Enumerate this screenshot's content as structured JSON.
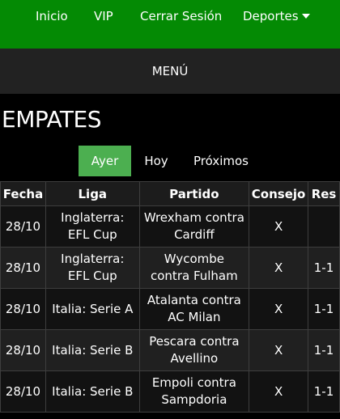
{
  "nav": {
    "items": [
      "Inicio",
      "VIP",
      "Cerrar Sesión",
      "Deportes"
    ]
  },
  "menu": {
    "label": "MENÚ"
  },
  "page": {
    "title": "EMPATES"
  },
  "tabs": [
    "Ayer",
    "Hoy",
    "Próximos"
  ],
  "table": {
    "headers": [
      "Fecha",
      "Liga",
      "Partido",
      "Consejo",
      "Res"
    ],
    "rows": [
      {
        "fecha": "28/10",
        "liga": "Inglaterra: EFL Cup",
        "partido": "Wrexham contra Cardiff",
        "consejo": "X",
        "res": ""
      },
      {
        "fecha": "28/10",
        "liga": "Inglaterra: EFL Cup",
        "partido": "Wycombe contra Fulham",
        "consejo": "X",
        "res": "1-1"
      },
      {
        "fecha": "28/10",
        "liga": "Italia: Serie A",
        "partido": "Atalanta contra AC Milan",
        "consejo": "X",
        "res": "1-1"
      },
      {
        "fecha": "28/10",
        "liga": "Italia: Serie B",
        "partido": "Pescara contra Avellino",
        "consejo": "X",
        "res": "1-1"
      },
      {
        "fecha": "28/10",
        "liga": "Italia: Serie B",
        "partido": "Empoli contra Sampdoria",
        "consejo": "X",
        "res": "1-1"
      }
    ]
  },
  "colors": {
    "nav_bg": "#048a04",
    "active_tab": "#4caf50",
    "menu_bg": "#222222",
    "page_bg": "#000000"
  },
  "icons": {
    "deportes_dropdown": "caret-down-icon"
  }
}
